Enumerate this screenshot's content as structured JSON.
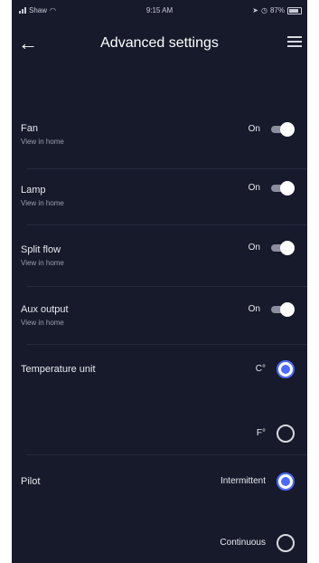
{
  "status_bar": {
    "carrier": "Shaw",
    "time": "9:15 AM",
    "battery": "87%"
  },
  "header": {
    "title": "Advanced settings",
    "back_icon": "arrow-left-icon",
    "menu_icon": "hamburger-menu-icon"
  },
  "settings": {
    "fan": {
      "label": "Fan",
      "sublabel": "View in home",
      "state": "On"
    },
    "lamp": {
      "label": "Lamp",
      "sublabel": "View in home",
      "state": "On"
    },
    "split_flow": {
      "label": "Split flow",
      "sublabel": "View in home",
      "state": "On"
    },
    "aux_output": {
      "label": "Aux output",
      "sublabel": "View in home",
      "state": "On"
    }
  },
  "temperature_unit": {
    "label": "Temperature unit",
    "options": [
      "C°",
      "F°"
    ],
    "selected": "C°"
  },
  "pilot": {
    "label": "Pilot",
    "options": [
      "Intermittent",
      "Continuous"
    ],
    "selected": "Intermittent"
  },
  "colors": {
    "background": "#171a2b",
    "accent": "#4b6bff",
    "text": "#e9eaf0"
  }
}
